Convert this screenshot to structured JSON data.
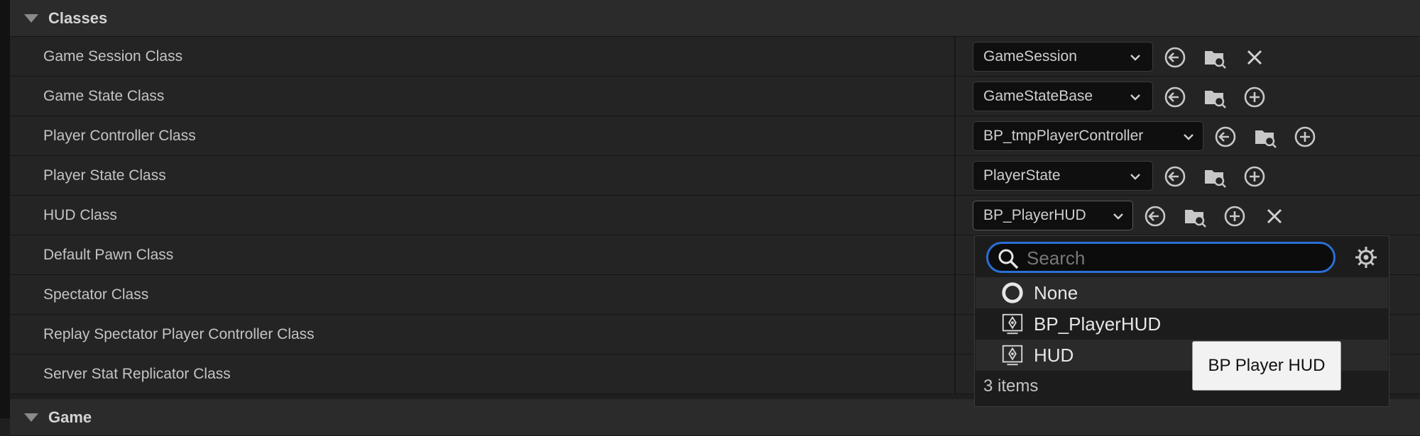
{
  "sections": {
    "classes": "Classes",
    "game": "Game"
  },
  "rows": [
    {
      "label": "Game Session Class",
      "value": "GameSession",
      "action": "clear"
    },
    {
      "label": "Game State Class",
      "value": "GameStateBase",
      "action": "add"
    },
    {
      "label": "Player Controller Class",
      "value": "BP_tmpPlayerController",
      "action": "add"
    },
    {
      "label": "Player State Class",
      "value": "PlayerState",
      "action": "add"
    },
    {
      "label": "HUD Class",
      "value": "BP_PlayerHUD",
      "action": "add+clear"
    },
    {
      "label": "Default Pawn Class"
    },
    {
      "label": "Spectator Class"
    },
    {
      "label": "Replay Spectator Player Controller Class"
    },
    {
      "label": "Server Stat Replicator Class"
    }
  ],
  "icons": {
    "use_selected": "arrow-left-circle-icon",
    "browse": "folder-search-icon",
    "add": "plus-circle-icon",
    "clear": "close-icon",
    "search": "search-icon",
    "settings": "gear-icon"
  },
  "picker": {
    "search_placeholder": "Search",
    "options": [
      {
        "label": "None",
        "icon": "none-circle-icon"
      },
      {
        "label": "BP_PlayerHUD",
        "icon": "class-icon"
      },
      {
        "label": "HUD",
        "icon": "class-icon"
      }
    ],
    "count": "3 items",
    "tooltip": "BP Player HUD"
  },
  "colors": {
    "focus_outline": "#2a6fd6",
    "background": "#1f1f1f"
  }
}
